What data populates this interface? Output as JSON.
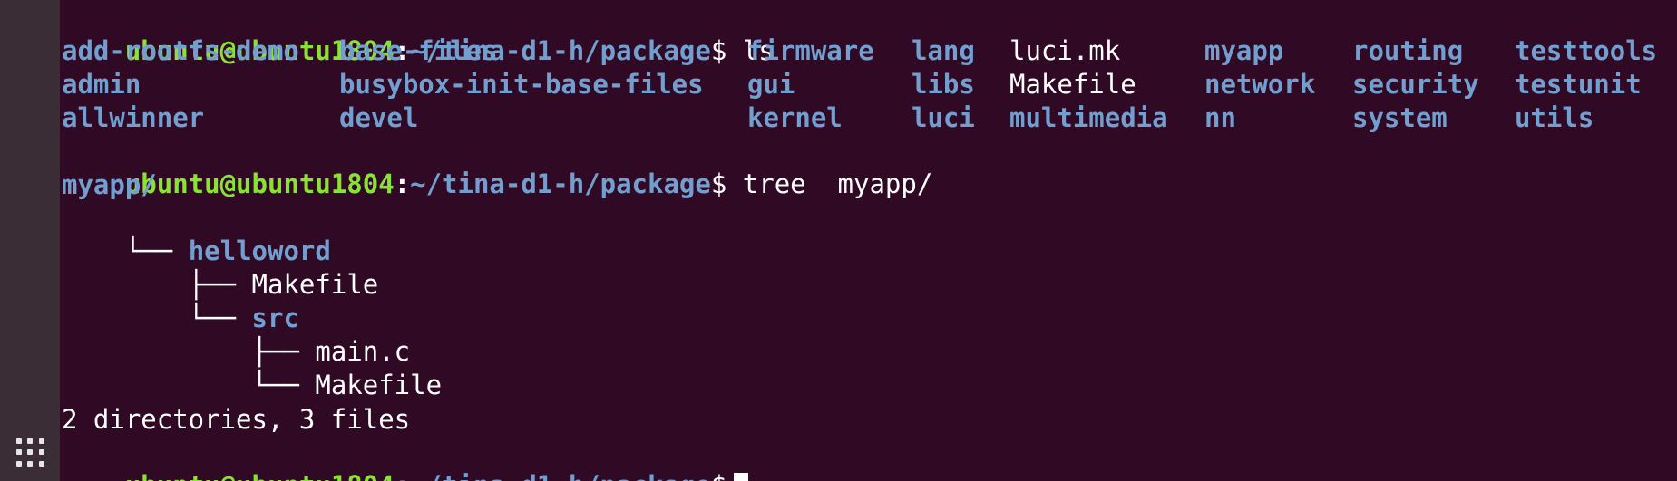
{
  "prompt": {
    "user_host": "ubuntu@ubuntu1804",
    "colon": ":",
    "path": "~/tina-d1-h/package",
    "dollar": "$"
  },
  "commands": {
    "ls": "ls",
    "tree": "tree  myapp/"
  },
  "ls_output": {
    "col1": [
      "add-rootfs-demo",
      "admin",
      "allwinner"
    ],
    "col2": [
      "base-files",
      "busybox-init-base-files",
      "devel"
    ],
    "col3": [
      "firmware",
      "gui",
      "kernel"
    ],
    "col4": [
      "lang",
      "libs",
      "luci"
    ],
    "col5": [
      "luci.mk",
      "Makefile",
      "multimedia"
    ],
    "col6": [
      "myapp",
      "network",
      "nn"
    ],
    "col7": [
      "routing",
      "security",
      "system"
    ],
    "col8": [
      "testtools",
      "testunit",
      "utils"
    ]
  },
  "tree_output": {
    "root": "myapp/",
    "helloword_prefix": "└── ",
    "helloword": "helloword",
    "makefile1_prefix": "    ├── ",
    "makefile1": "Makefile",
    "src_prefix": "    └── ",
    "src": "src",
    "mainc_prefix": "        ├── ",
    "mainc": "main.c",
    "makefile2_prefix": "        └── ",
    "makefile2": "Makefile",
    "summary": "2 directories, 3 files"
  },
  "icons": {
    "dock_apps": "show-applications-icon"
  },
  "colors": {
    "background": "#300a24",
    "prompt_user": "#8ae234",
    "directory": "#729fcf",
    "text": "#ffffff"
  }
}
